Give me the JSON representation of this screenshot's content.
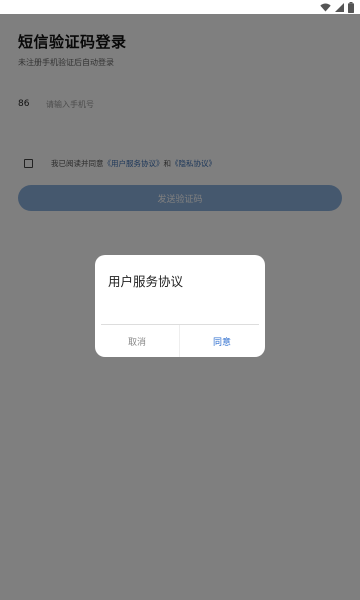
{
  "status_bar": {
    "icons": [
      "wifi-icon",
      "signal-icon",
      "battery-icon"
    ]
  },
  "login": {
    "title": "短信验证码登录",
    "subtitle": "未注册手机验证后自动登录",
    "country_code": "86",
    "phone_placeholder": "请输入手机号",
    "agreement": {
      "prefix": "我已阅读并同意",
      "user_agreement_link": "《用户服务协议》",
      "and": "和",
      "privacy_link": "《隐私协议》"
    },
    "send_code_button": "发送验证码"
  },
  "dialog": {
    "title": "用户服务协议",
    "cancel_label": "取消",
    "agree_label": "同意"
  },
  "colors": {
    "accent": "#8bb0dd",
    "link": "#3a6fb4",
    "dialog_agree": "#2f6fcf",
    "overlay": "rgba(0,0,0,0.5)"
  }
}
